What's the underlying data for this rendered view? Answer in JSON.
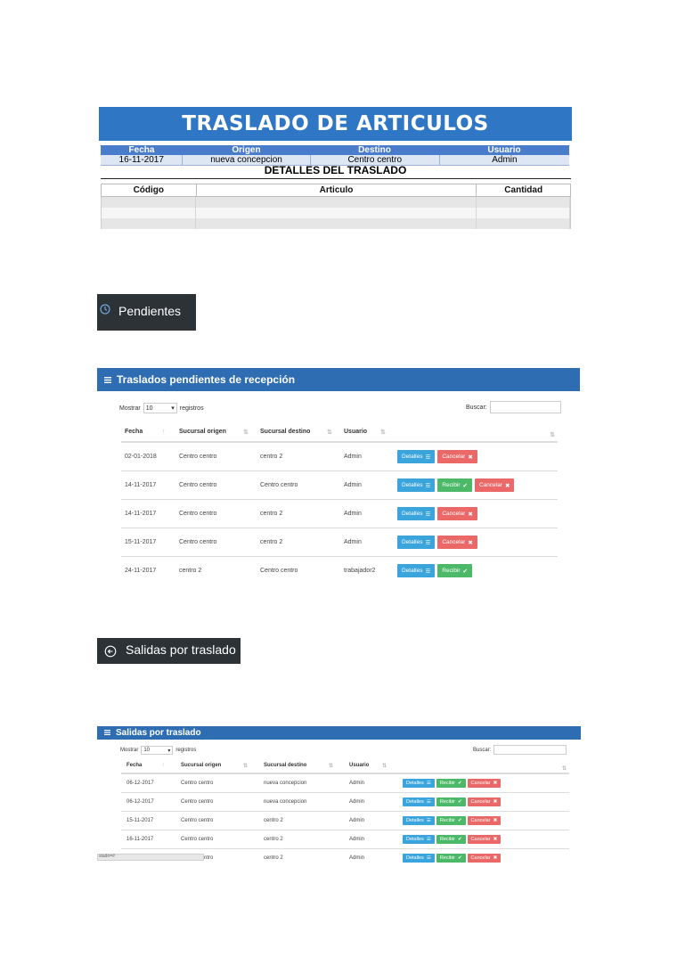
{
  "traslado_doc": {
    "title": "TRASLADO DE ARTICULOS",
    "headers": [
      "Fecha",
      "Origen",
      "Destino",
      "Usuario"
    ],
    "values": [
      "16-11-2017",
      "nueva concepcion",
      "Centro centro",
      "Admin"
    ],
    "details_title": "DETALLES DEL TRASLADO",
    "detail_headers": [
      "Código",
      "Articulo",
      "Cantidad"
    ],
    "detail_rows": 3
  },
  "pendientes_button": {
    "label": "Pendientes",
    "icon": "clock-icon"
  },
  "panel_pendientes": {
    "title": "Traslados pendientes de recepción",
    "show_label": "Mostrar",
    "show_value": "10",
    "records_label": "registros",
    "search_label": "Buscar:",
    "columns": [
      "Fecha",
      "Sucursal origen",
      "Sucursal destino",
      "Usuario",
      ""
    ],
    "rows": [
      {
        "fecha": "02-01-2018",
        "origen": "Centro centro",
        "destino": "centro 2",
        "usuario": "Admin",
        "actions": [
          "Detalles",
          "Cancelar"
        ]
      },
      {
        "fecha": "14-11-2017",
        "origen": "Centro centro",
        "destino": "Centro centro",
        "usuario": "Admin",
        "actions": [
          "Detalles",
          "Recibir",
          "Cancelar"
        ]
      },
      {
        "fecha": "14-11-2017",
        "origen": "Centro centro",
        "destino": "centro 2",
        "usuario": "Admin",
        "actions": [
          "Detalles",
          "Cancelar"
        ]
      },
      {
        "fecha": "15-11-2017",
        "origen": "Centro centro",
        "destino": "centro 2",
        "usuario": "Admin",
        "actions": [
          "Detalles",
          "Cancelar"
        ]
      },
      {
        "fecha": "24-11-2017",
        "origen": "centro 2",
        "destino": "Centro centro",
        "usuario": "trabajador2",
        "actions": [
          "Detalles",
          "Recibir"
        ]
      }
    ]
  },
  "salidas_button": {
    "label": "Salidas por traslado",
    "icon": "circle-arrow-left-icon"
  },
  "panel_salidas": {
    "title": "Salidas por traslado",
    "show_label": "Mostrar",
    "show_value": "10",
    "records_label": "registros",
    "search_label": "Buscar:",
    "columns": [
      "Fecha",
      "Sucursal origen",
      "Sucursal destino",
      "Usuario",
      ""
    ],
    "rows": [
      {
        "fecha": "06-12-2017",
        "origen": "Centro centro",
        "destino": "nueva concepcion",
        "usuario": "Admin",
        "actions": [
          "Detalles",
          "Recibir",
          "Cancelar"
        ]
      },
      {
        "fecha": "06-12-2017",
        "origen": "Centro centro",
        "destino": "nueva concepcion",
        "usuario": "Admin",
        "actions": [
          "Detalles",
          "Recibir",
          "Cancelar"
        ]
      },
      {
        "fecha": "15-11-2017",
        "origen": "Centro centro",
        "destino": "centro 2",
        "usuario": "Admin",
        "actions": [
          "Detalles",
          "Recibir",
          "Cancelar"
        ]
      },
      {
        "fecha": "16-11-2017",
        "origen": "Centro centro",
        "destino": "centro 2",
        "usuario": "Admin",
        "actions": [
          "Detalles",
          "Recibir",
          "Cancelar"
        ]
      },
      {
        "fecha": "16-11-2017",
        "origen": "Centro centro",
        "destino": "centro 2",
        "usuario": "Admin",
        "actions": [
          "Detalles",
          "Recibir",
          "Cancelar"
        ]
      }
    ],
    "status_text": "stado=#"
  },
  "colors": {
    "header_blue": "#2f6db3",
    "info": "#3aa5dc",
    "success": "#4cb968",
    "danger": "#ea6868",
    "dark": "#2d3237"
  }
}
